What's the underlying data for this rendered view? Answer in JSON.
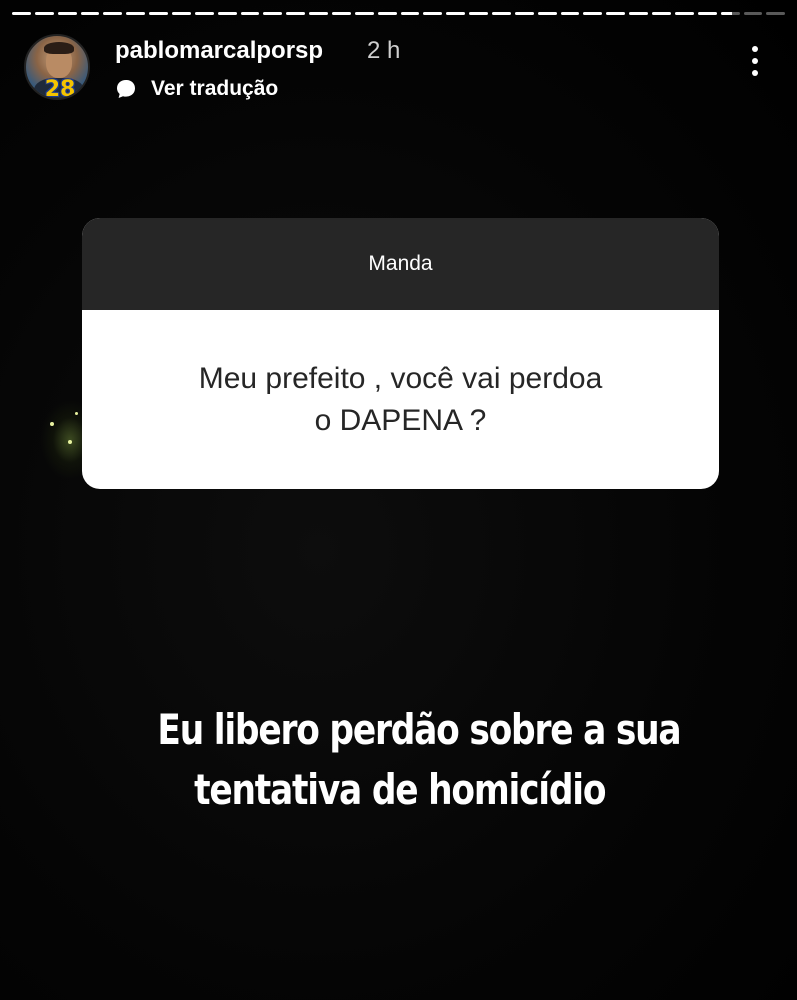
{
  "story": {
    "progress_segments": [
      1,
      1,
      1,
      1,
      1,
      1,
      1,
      1,
      1,
      1,
      1,
      1,
      1,
      1,
      1,
      1,
      1,
      1,
      1,
      1,
      1,
      1,
      1,
      1,
      1,
      1,
      1,
      1,
      1,
      1,
      1,
      0.6,
      0,
      0
    ]
  },
  "header": {
    "avatar_badge": "28",
    "username": "pablomarcalporsp",
    "timestamp": "2 h",
    "translate_label": "Ver tradução",
    "more_icon": "more-vertical-icon",
    "translate_icon": "speech-bubble-icon"
  },
  "question_card": {
    "title": "Manda",
    "question_line1": "Meu prefeito , você vai perdoa",
    "question_line2": "o DAPENA ?",
    "header_color": "#262626",
    "body_color": "#ffffff"
  },
  "answer": {
    "line1": "Eu libero perdão sobre a sua",
    "line2": "tentativa de homicídio"
  }
}
